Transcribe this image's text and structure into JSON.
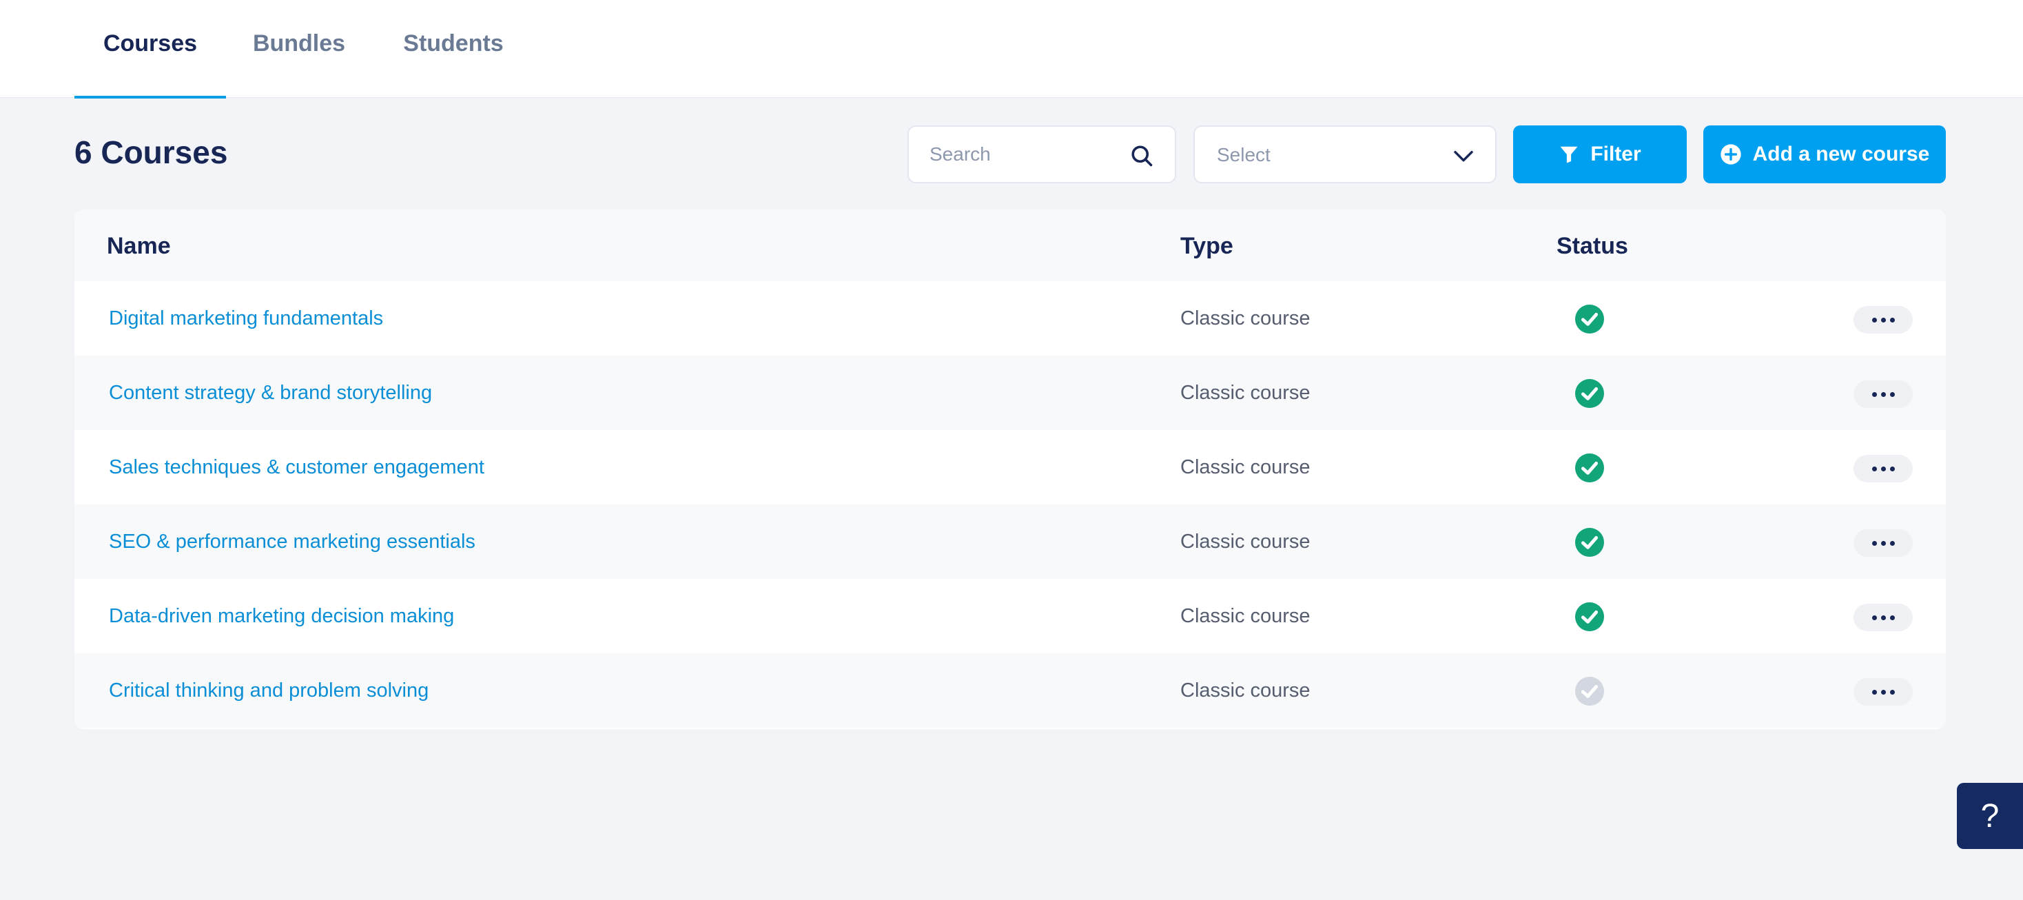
{
  "tabs": [
    {
      "label": "Courses",
      "active": true
    },
    {
      "label": "Bundles",
      "active": false
    },
    {
      "label": "Students",
      "active": false
    }
  ],
  "page_title": "6 Courses",
  "search": {
    "placeholder": "Search",
    "icon": "search-icon"
  },
  "select": {
    "value": "Select",
    "icon": "chevron-down-icon"
  },
  "buttons": {
    "filter_label": "Filter",
    "filter_icon": "funnel-icon",
    "add_label": "Add a new course",
    "add_icon": "plus-circle-icon"
  },
  "table": {
    "headers": {
      "name": "Name",
      "type": "Type",
      "status": "Status"
    },
    "rows": [
      {
        "name": "Digital marketing fundamentals",
        "type": "Classic course",
        "status": "published"
      },
      {
        "name": "Content strategy & brand storytelling",
        "type": "Classic course",
        "status": "published"
      },
      {
        "name": "Sales techniques & customer engagement",
        "type": "Classic course",
        "status": "published"
      },
      {
        "name": "SEO & performance marketing essentials",
        "type": "Classic course",
        "status": "published"
      },
      {
        "name": "Data-driven marketing decision making",
        "type": "Classic course",
        "status": "published"
      },
      {
        "name": "Critical thinking and problem solving",
        "type": "Classic course",
        "status": "unpublished"
      }
    ]
  },
  "help_label": "?",
  "colors": {
    "accent": "#00a0f0",
    "link": "#0a8ed6",
    "heading": "#172655",
    "status_published": "#13a57a",
    "status_unpublished": "#d3d7e0",
    "help_bg": "#142a61"
  }
}
